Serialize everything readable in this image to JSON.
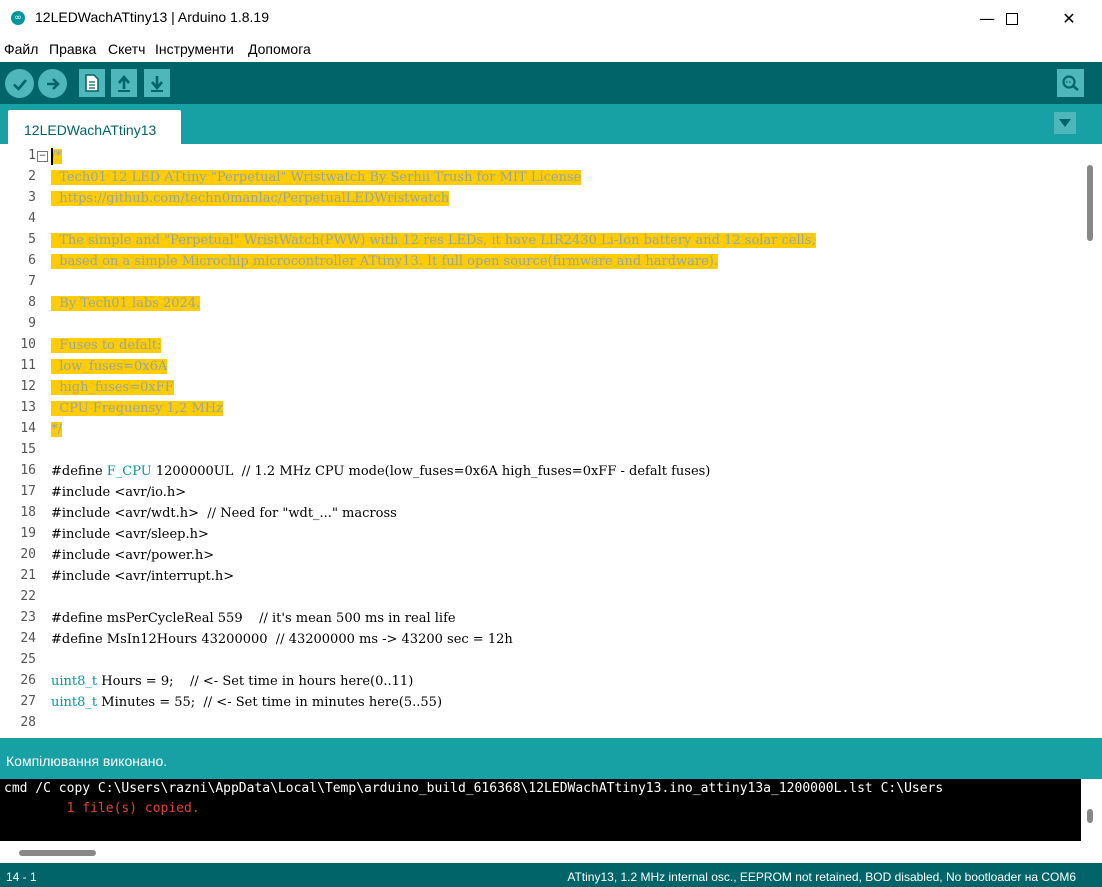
{
  "window": {
    "title": "12LEDWachATtiny13 | Arduino 1.8.19"
  },
  "menu": [
    "Файл",
    "Правка",
    "Скетч",
    "Інструменти",
    "Допомога"
  ],
  "tab": {
    "label": "12LEDWachATtiny13"
  },
  "code_lines": [
    {
      "n": "1",
      "text": "/*",
      "style": "hl"
    },
    {
      "n": "2",
      "text": "  Tech01 12 LED ATtiny \"Perpetual\" Wristwatch By Serhii Trush for MIT License",
      "style": "hl"
    },
    {
      "n": "3",
      "text": "  https://github.com/techn0manlac/PerpetualLEDWristwatch",
      "style": "hl"
    },
    {
      "n": "4",
      "text": "",
      "style": ""
    },
    {
      "n": "5",
      "text": "  The simple and \"Perpetual\" WristWatch(PWW) with 12 res LEDs, it have LIR2430 Li-Ion battery and 12 solar cells,",
      "style": "hl"
    },
    {
      "n": "6",
      "text": "  based on a simple Microchip microcontroller ATtiny13. It full open source(firmware and hardware).",
      "style": "hl"
    },
    {
      "n": "7",
      "text": "",
      "style": ""
    },
    {
      "n": "8",
      "text": "  By Tech01 labs 2024.",
      "style": "hl"
    },
    {
      "n": "9",
      "text": "",
      "style": ""
    },
    {
      "n": "10",
      "text": "  Fuses to defalt:",
      "style": "hl"
    },
    {
      "n": "11",
      "text": "  low_fuses=0x6A",
      "style": "hl"
    },
    {
      "n": "12",
      "text": "  high_fuses=0xFF",
      "style": "hl"
    },
    {
      "n": "13",
      "text": "  CPU Frequensy 1,2 MHz",
      "style": "hl"
    },
    {
      "n": "14",
      "text": "*/",
      "style": "hl"
    },
    {
      "n": "15",
      "text": "",
      "style": ""
    },
    {
      "n": "16",
      "kw": "",
      "pre": "#define ",
      "kw2": "F_CPU",
      "text": " 1200000UL  // 1.2 MHz CPU mode(low_fuses=0x6A high_fuses=0xFF - defalt fuses)",
      "style": "mix"
    },
    {
      "n": "17",
      "text": "#include <avr/io.h>",
      "style": ""
    },
    {
      "n": "18",
      "text": "#include <avr/wdt.h>  // Need for \"wdt_...\" macross",
      "style": ""
    },
    {
      "n": "19",
      "text": "#include <avr/sleep.h>",
      "style": ""
    },
    {
      "n": "20",
      "text": "#include <avr/power.h>",
      "style": ""
    },
    {
      "n": "21",
      "text": "#include <avr/interrupt.h>",
      "style": ""
    },
    {
      "n": "22",
      "text": "",
      "style": ""
    },
    {
      "n": "23",
      "text": "#define msPerCycleReal 559    // it's mean 500 ms in real life",
      "style": ""
    },
    {
      "n": "24",
      "text": "#define MsIn12Hours 43200000  // 43200000 ms -> 43200 sec = 12h",
      "style": ""
    },
    {
      "n": "25",
      "text": "",
      "style": ""
    },
    {
      "n": "26",
      "pre": "",
      "kw2": "uint8_t",
      "text": " Hours = 9;    // <- Set time in hours here(0..11)",
      "style": "mix"
    },
    {
      "n": "27",
      "pre": "",
      "kw2": "uint8_t",
      "text": " Minutes = 55;  // <- Set time in minutes here(5..55)",
      "style": "mix"
    },
    {
      "n": "28",
      "text": "",
      "style": ""
    }
  ],
  "status": {
    "message": "Компілювання виконано."
  },
  "console": {
    "line1": "cmd /C copy C:\\Users\\razni\\AppData\\Local\\Temp\\arduino_build_616368\\12LEDWachATtiny13.ino_attiny13a_1200000L.lst C:\\Users",
    "line2": "        1 file(s) copied.",
    "line1_color": "#ffffff",
    "line2_color": "#e3442c"
  },
  "footer": {
    "position": "14 - 1",
    "board": "ATtiny13, 1.2 MHz internal osc., EEPROM not retained, BOD disabled, No bootloader на COM6"
  },
  "colors": {
    "toolbar": "#006468",
    "tabbar": "#17a1a5",
    "highlight": "#ffcc00",
    "keyword": "#00979c"
  }
}
